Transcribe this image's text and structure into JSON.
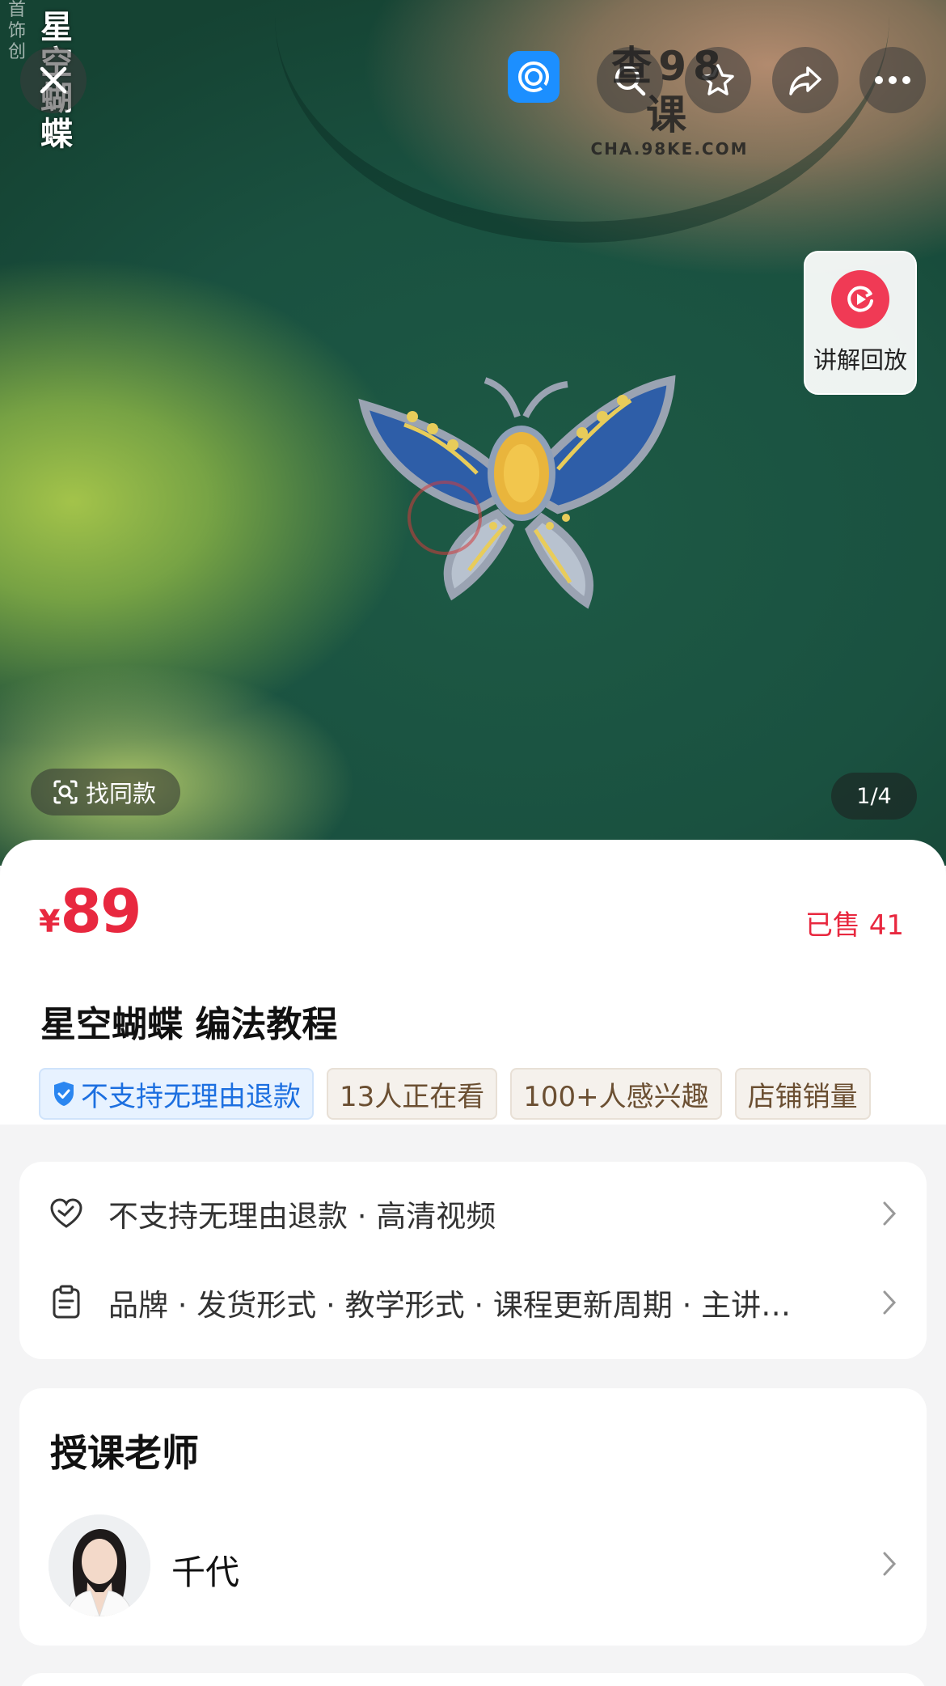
{
  "hero": {
    "side_title": "星空蝴蝶",
    "side_small": "首饰创",
    "page_counter": "1/4",
    "find_same_label": "找同款",
    "replay_label": "讲解回放"
  },
  "header": {
    "logo_main": "查98课",
    "logo_sub": "CHA.98KE.COM"
  },
  "product": {
    "currency": "¥",
    "price": "89",
    "sold": "已售 41",
    "title": "星空蝴蝶 编法教程",
    "tags": [
      "不支持无理由退款",
      "13人正在看",
      "100+人感兴趣",
      "店铺销量"
    ]
  },
  "info": {
    "row1": "不支持无理由退款 · 高清视频",
    "row2": "品牌 · 发货形式 · 教学形式 · 课程更新周期 · 主讲…"
  },
  "teacher": {
    "section_title": "授课老师",
    "name": "千代"
  },
  "colors": {
    "accent_red": "#e8283f",
    "tag_blue": "#1c6fe0",
    "replay_red": "#f03a55"
  },
  "icons": [
    "close-icon",
    "app-logo-icon",
    "search-icon",
    "star-icon",
    "share-icon",
    "more-icon",
    "replay-icon",
    "scan-icon",
    "shield-icon",
    "heart-check-icon",
    "clipboard-icon",
    "chevron-right-icon"
  ]
}
